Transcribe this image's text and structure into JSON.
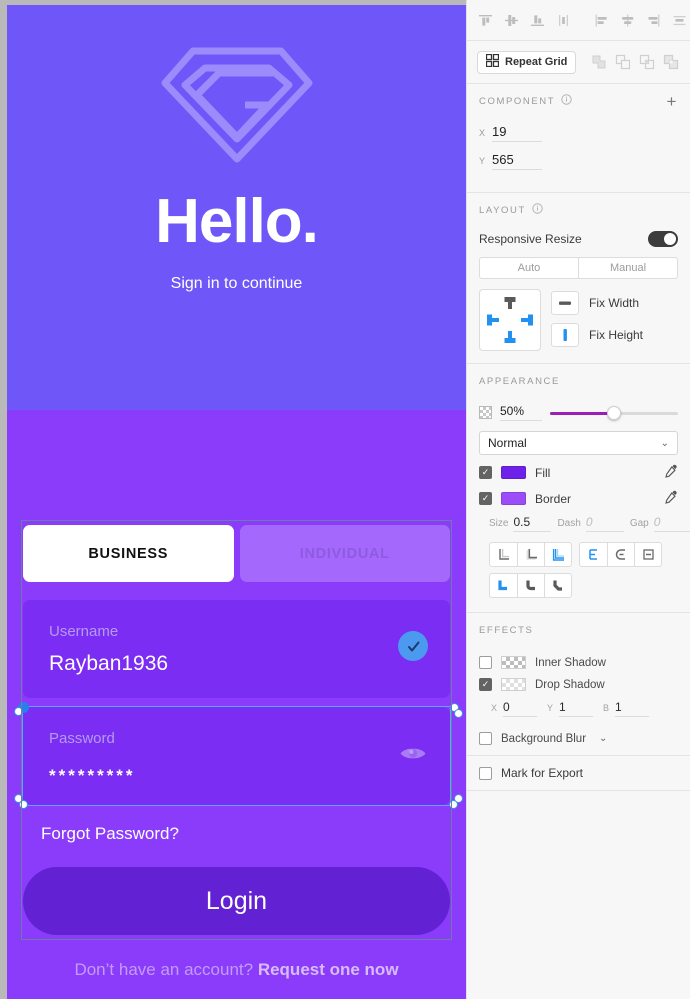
{
  "canvas": {
    "artboard_bg": "#6E56F8",
    "lower_bg": "#8B3CFB",
    "logo_name": "diamond-g-logo",
    "heading": "Hello.",
    "subtitle": "Sign in to continue",
    "tabs": [
      {
        "label": "BUSINESS",
        "active": true
      },
      {
        "label": "INDIVIDUAL",
        "active": false
      }
    ],
    "fields": [
      {
        "label": "Username",
        "value": "Rayban1936",
        "icon": "check-circle-icon"
      },
      {
        "label": "Password",
        "value": "*********",
        "icon": "eye-icon"
      }
    ],
    "forgot_password": "Forgot Password?",
    "login_label": "Login",
    "signup_prefix": "Don’t have an account? ",
    "signup_link": "Request one now"
  },
  "panel": {
    "align_vertical": [
      "align-top-icon",
      "align-middle-icon",
      "align-bottom-icon",
      "distribute-vertical-icon"
    ],
    "align_horizontal": [
      "align-left-icon",
      "align-center-icon",
      "align-right-icon",
      "distribute-horizontal-icon"
    ],
    "repeat_grid_label": "Repeat Grid",
    "boolean_ops": [
      "union-icon",
      "subtract-icon",
      "intersect-icon",
      "exclude-icon"
    ],
    "component": {
      "title": "COMPONENT",
      "add_label": "+",
      "x_label": "X",
      "x_value": "19",
      "y_label": "Y",
      "y_value": "565"
    },
    "layout": {
      "title": "LAYOUT",
      "responsive_resize_label": "Responsive Resize",
      "responsive_on": true,
      "mode_auto": "Auto",
      "mode_manual": "Manual",
      "fix_width_label": "Fix Width",
      "fix_height_label": "Fix Height"
    },
    "appearance": {
      "title": "APPEARANCE",
      "opacity": "50%",
      "opacity_percent": 50,
      "blend_mode": "Normal",
      "fill_label": "Fill",
      "fill_checked": true,
      "fill_color": "#6E21E8",
      "border_label": "Border",
      "border_checked": true,
      "border_color": "#9B4DF7",
      "size_label": "Size",
      "size_value": "0.5",
      "dash_label": "Dash",
      "dash_value": "0",
      "gap_label": "Gap",
      "gap_value": "0",
      "stroke_align": [
        "stroke-inside-icon",
        "stroke-center-icon",
        "stroke-outside-icon"
      ],
      "stroke_caps": [
        "cap-butt-icon",
        "cap-round-icon",
        "cap-square-icon"
      ],
      "stroke_joins": [
        "join-miter-icon",
        "join-round-icon",
        "join-bevel-icon"
      ]
    },
    "effects": {
      "title": "EFFECTS",
      "inner_shadow_label": "Inner Shadow",
      "inner_shadow_checked": false,
      "drop_shadow_label": "Drop Shadow",
      "drop_shadow_checked": true,
      "shadow_x_label": "X",
      "shadow_x": "0",
      "shadow_y_label": "Y",
      "shadow_y": "1",
      "shadow_b_label": "B",
      "shadow_b": "1",
      "background_blur_label": "Background Blur",
      "background_blur_checked": false
    },
    "export": {
      "mark_for_export_label": "Mark for Export",
      "checked": false
    }
  }
}
